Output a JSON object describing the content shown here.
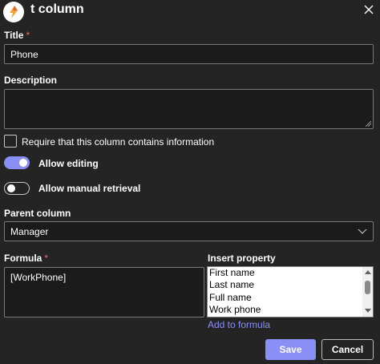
{
  "header": {
    "title": "t column",
    "logo_icon": "app-logo-icon",
    "close_icon": "close-icon"
  },
  "title_field": {
    "label": "Title",
    "required_mark": "*",
    "value": "Phone"
  },
  "description_field": {
    "label": "Description",
    "value": ""
  },
  "require_checkbox": {
    "label": "Require that this column contains information",
    "checked": false
  },
  "allow_editing": {
    "label": "Allow editing",
    "on": true
  },
  "allow_manual_retrieval": {
    "label": "Allow manual retrieval",
    "on": false
  },
  "parent_column": {
    "label": "Parent column",
    "selected": "Manager"
  },
  "formula": {
    "label": "Formula",
    "required_mark": "*",
    "value": "[WorkPhone]"
  },
  "insert_property": {
    "label": "Insert property",
    "items": [
      "First name",
      "Last name",
      "Full name",
      "Work phone"
    ],
    "add_link": "Add to formula"
  },
  "buttons": {
    "save": "Save",
    "cancel": "Cancel"
  },
  "colors": {
    "accent": "#8a8ff5",
    "background": "#242424",
    "required": "#e86a6a"
  }
}
